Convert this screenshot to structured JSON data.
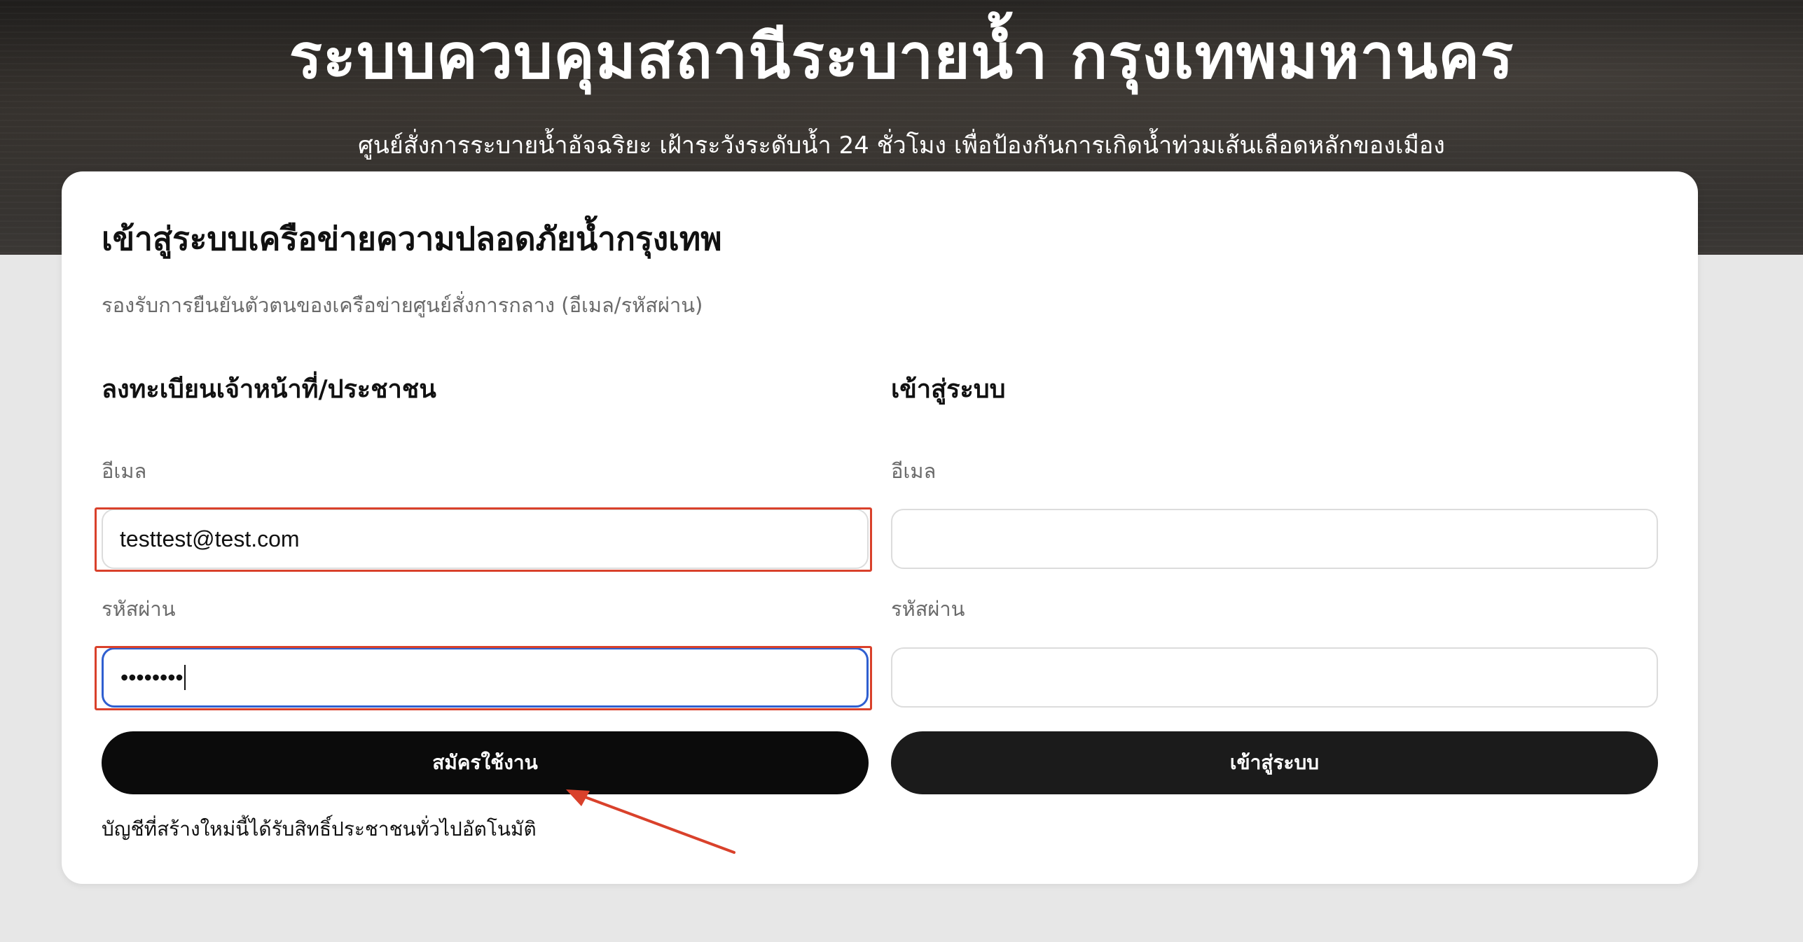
{
  "hero": {
    "title": "ระบบควบคุมสถานีระบายน้ำ กรุงเทพมหานคร",
    "subtitle": "ศูนย์สั่งการระบายน้ำอัจฉริยะ เฝ้าระวังระดับน้ำ 24 ชั่วโมง เพื่อป้องกันการเกิดน้ำท่วมเส้นเลือดหลักของเมือง"
  },
  "card": {
    "title": "เข้าสู่ระบบเครือข่ายความปลอดภัยน้ำกรุงเทพ",
    "description": "รองรับการยืนยันตัวตนของเครือข่ายศูนย์สั่งการกลาง (อีเมล/รหัสผ่าน)"
  },
  "register": {
    "title": "ลงทะเบียนเจ้าหน้าที่/ประชาชน",
    "email_label": "อีเมล",
    "email_value": "testtest@test.com",
    "password_label": "รหัสผ่าน",
    "password_value": "••••••••",
    "button_label": "สมัครใช้งาน",
    "note": "บัญชีที่สร้างใหม่นี้ได้รับสิทธิ์ประชาชนทั่วไปอัตโนมัติ"
  },
  "login": {
    "title": "เข้าสู่ระบบ",
    "email_label": "อีเมล",
    "email_value": "",
    "password_label": "รหัสผ่าน",
    "password_value": "",
    "button_label": "เข้าสู่ระบบ"
  },
  "colors": {
    "highlight": "#d9412b",
    "focus": "#2f5fd0",
    "button": "#0b0b0b"
  }
}
